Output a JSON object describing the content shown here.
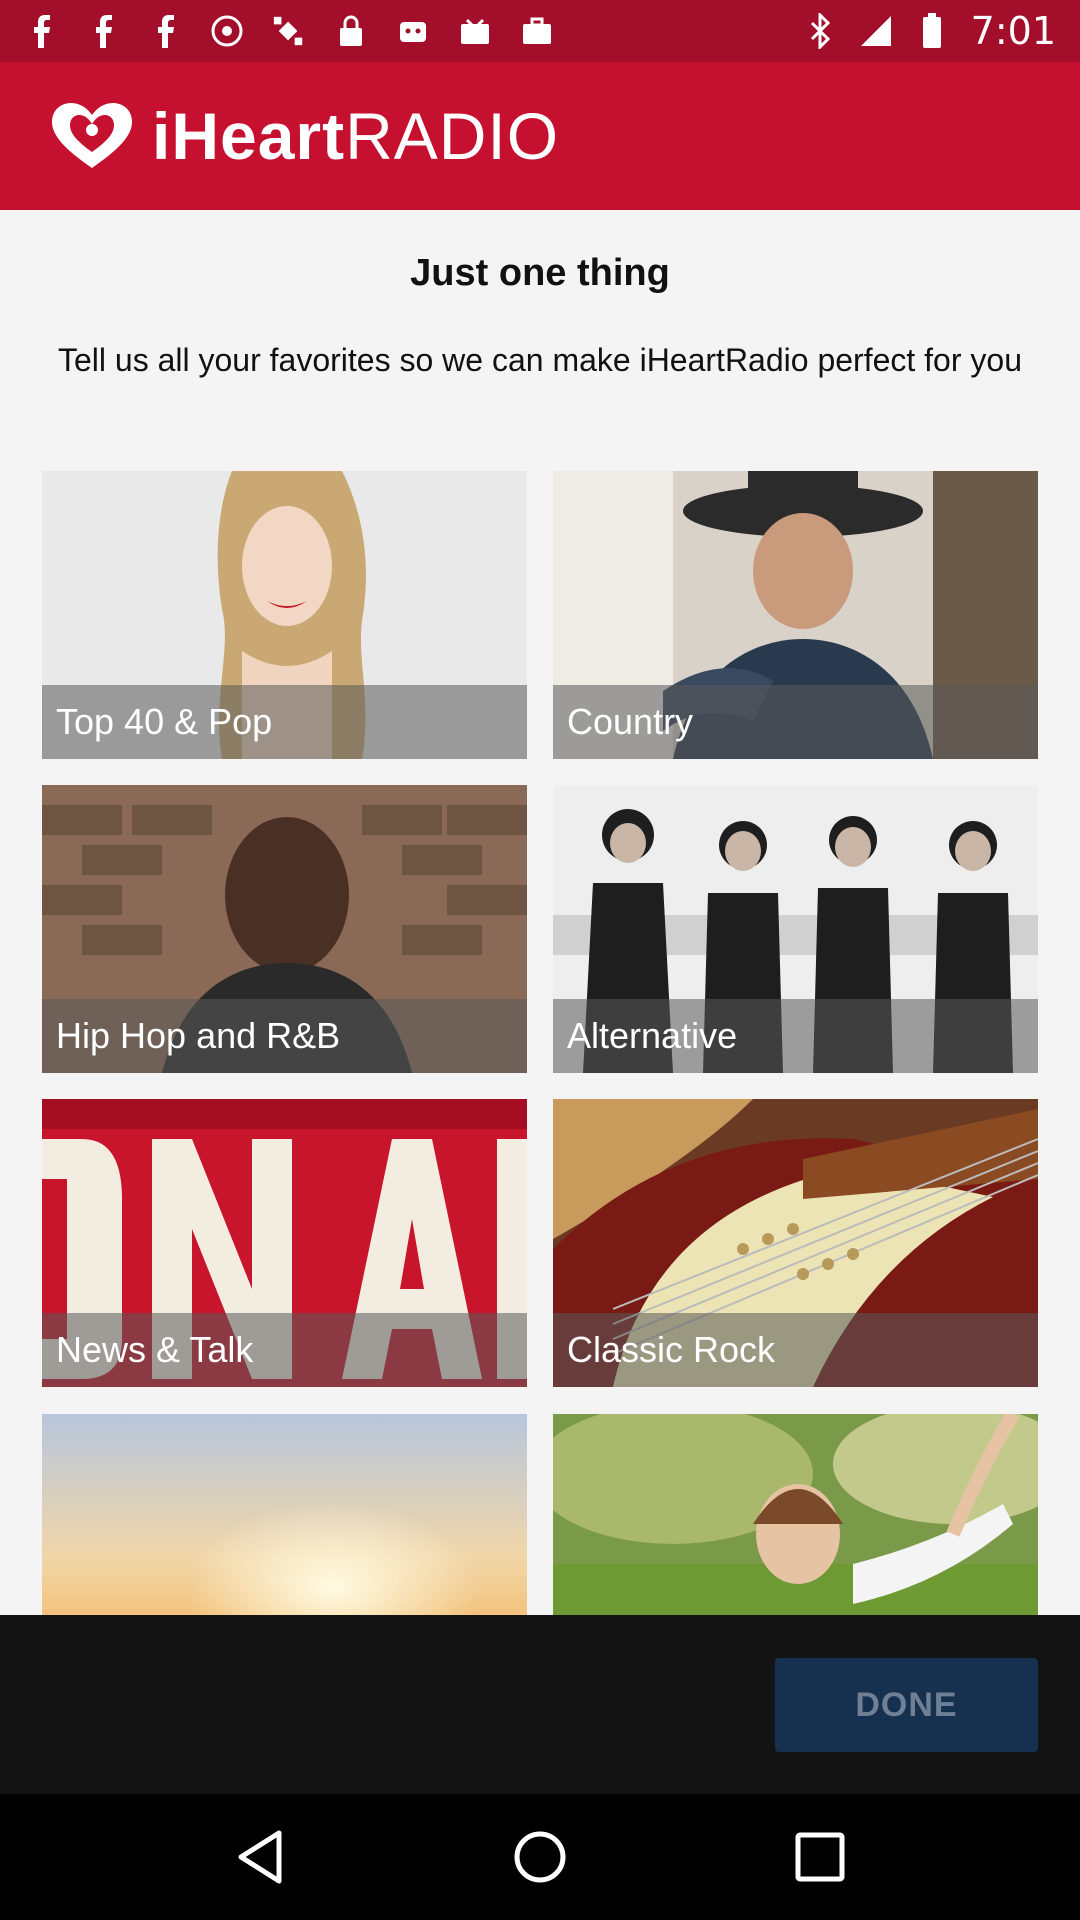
{
  "status_bar": {
    "time": "7:01",
    "left_icons": [
      "facebook-icon",
      "facebook-icon",
      "facebook-icon",
      "hotspot-icon",
      "fake-gps-icon",
      "lock-icon",
      "robot-icon",
      "inbox-icon",
      "briefcase-icon"
    ],
    "right_icons": [
      "bluetooth-icon",
      "signal-icon",
      "battery-icon"
    ]
  },
  "header": {
    "logo_bold": "iHeart",
    "logo_light": "RADIO",
    "brand_color": "#c5102f"
  },
  "intro": {
    "title": "Just one thing",
    "subtitle": "Tell us all your favorites so we can make iHeartRadio perfect for you"
  },
  "genres": [
    {
      "label": "Top 40 & Pop"
    },
    {
      "label": "Country"
    },
    {
      "label": "Hip Hop and R&B"
    },
    {
      "label": "Alternative"
    },
    {
      "label": "News & Talk"
    },
    {
      "label": "Classic Rock"
    },
    {
      "label": ""
    },
    {
      "label": ""
    }
  ],
  "action_bar": {
    "done_label": "DONE"
  },
  "nav": {
    "back": "back-icon",
    "home": "home-icon",
    "recents": "recents-icon"
  }
}
